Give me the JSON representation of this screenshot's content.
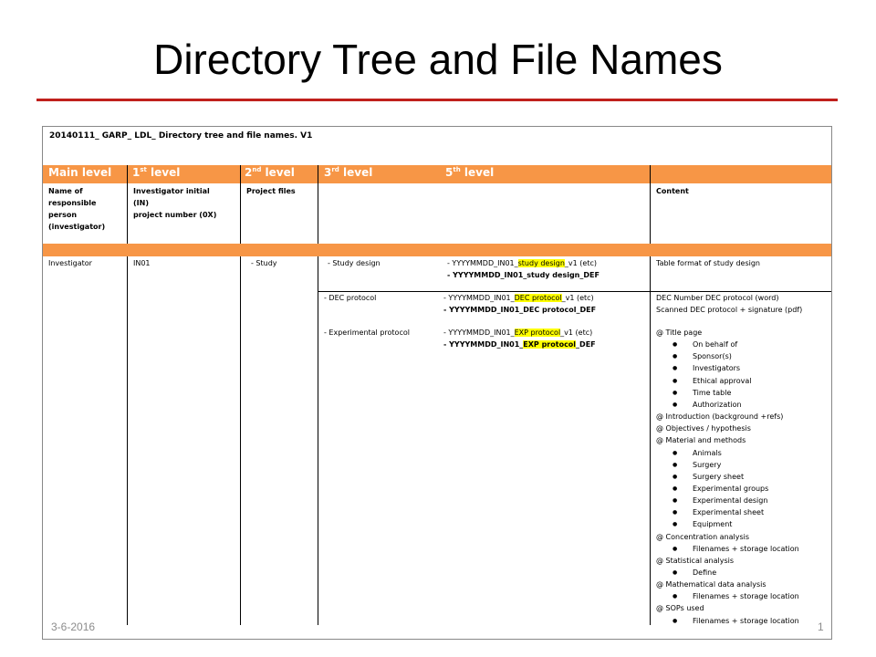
{
  "slide": {
    "title": "Directory Tree and File Names",
    "date": "3-6-2016",
    "page_number": "1",
    "accent_color": "#c0201c",
    "header_color": "#f79646",
    "highlight_color": "#ffff00"
  },
  "doc": {
    "header": "20140111_ GARP_ LDL_ Directory tree and file names. V1",
    "levels": {
      "main": "Main level",
      "l1_num": "1",
      "l1_sup": "st",
      "l1_rest": " level",
      "l2_num": "2",
      "l2_sup": "nd",
      "l2_rest": " level",
      "l3_num": "3",
      "l3_sup": "rd",
      "l3_rest": " level",
      "l5_num": "5",
      "l5_sup": "th",
      "l5_rest": " level"
    },
    "subheaders": {
      "col1": [
        "Name of",
        "responsible",
        "person",
        "(investigator)"
      ],
      "col2": [
        "Investigator initial",
        "(IN)",
        "project number (0X)"
      ],
      "col3": "Project files",
      "content": "Content"
    },
    "row": {
      "investigator": "Investigator",
      "initial": "IN01",
      "project": "- Study"
    },
    "study_design": {
      "folder": "- Study design",
      "file1_pre": "- YYYYMMDD_IN01_",
      "file1_hl": "study design",
      "file1_post": "_v1 (etc)",
      "file2": "- YYYYMMDD_IN01_study design_DEF",
      "content": "Table format of study design"
    },
    "dec": {
      "folder": "- DEC protocol",
      "file1_pre": "- YYYYMMDD_IN01_",
      "file1_hl": "DEC protocol",
      "file1_post": "_v1 (etc)",
      "file2": "- YYYYMMDD_IN01_DEC protocol_DEF",
      "content1": "DEC Number DEC protocol (word)",
      "content2": "Scanned DEC protocol + signature (pdf)"
    },
    "exp": {
      "folder": "- Experimental protocol",
      "file1_pre": "- YYYYMMDD_IN01_",
      "file1_hl": "EXP protocol",
      "file1_post": "_v1 (etc)",
      "file2_pre": "- YYYYMMDD_IN01_",
      "file2_hl": "EXP protocol",
      "file2_post": "_DEF"
    },
    "content_list": [
      {
        "type": "head",
        "text": "@ Title page"
      },
      {
        "type": "bullet",
        "text": "On behalf of"
      },
      {
        "type": "bullet",
        "text": "Sponsor(s)"
      },
      {
        "type": "bullet",
        "text": "Investigators"
      },
      {
        "type": "bullet",
        "text": "Ethical approval"
      },
      {
        "type": "bullet",
        "text": "Time table"
      },
      {
        "type": "bullet",
        "text": "Authorization"
      },
      {
        "type": "head",
        "text": "@ Introduction (background +refs)"
      },
      {
        "type": "head",
        "text": "@ Objectives / hypothesis"
      },
      {
        "type": "head",
        "text": "@ Material and methods"
      },
      {
        "type": "bullet",
        "text": "Animals"
      },
      {
        "type": "bullet",
        "text": "Surgery"
      },
      {
        "type": "bullet",
        "text": "Surgery sheet"
      },
      {
        "type": "bullet",
        "text": "Experimental groups"
      },
      {
        "type": "bullet",
        "text": "Experimental design"
      },
      {
        "type": "bullet",
        "text": "Experimental sheet"
      },
      {
        "type": "bullet",
        "text": "Equipment"
      },
      {
        "type": "head",
        "text": "@ Concentration analysis"
      },
      {
        "type": "bullet",
        "text": "Filenames + storage location"
      },
      {
        "type": "head",
        "text": "@ Statistical analysis"
      },
      {
        "type": "bullet",
        "text": "Define"
      },
      {
        "type": "head",
        "text": "@ Mathematical data analysis"
      },
      {
        "type": "bullet",
        "text": "Filenames + storage location"
      },
      {
        "type": "head",
        "text": "@ SOPs used"
      },
      {
        "type": "bullet",
        "text": "Filenames + storage location"
      }
    ],
    "bullet_glyph": "●"
  }
}
